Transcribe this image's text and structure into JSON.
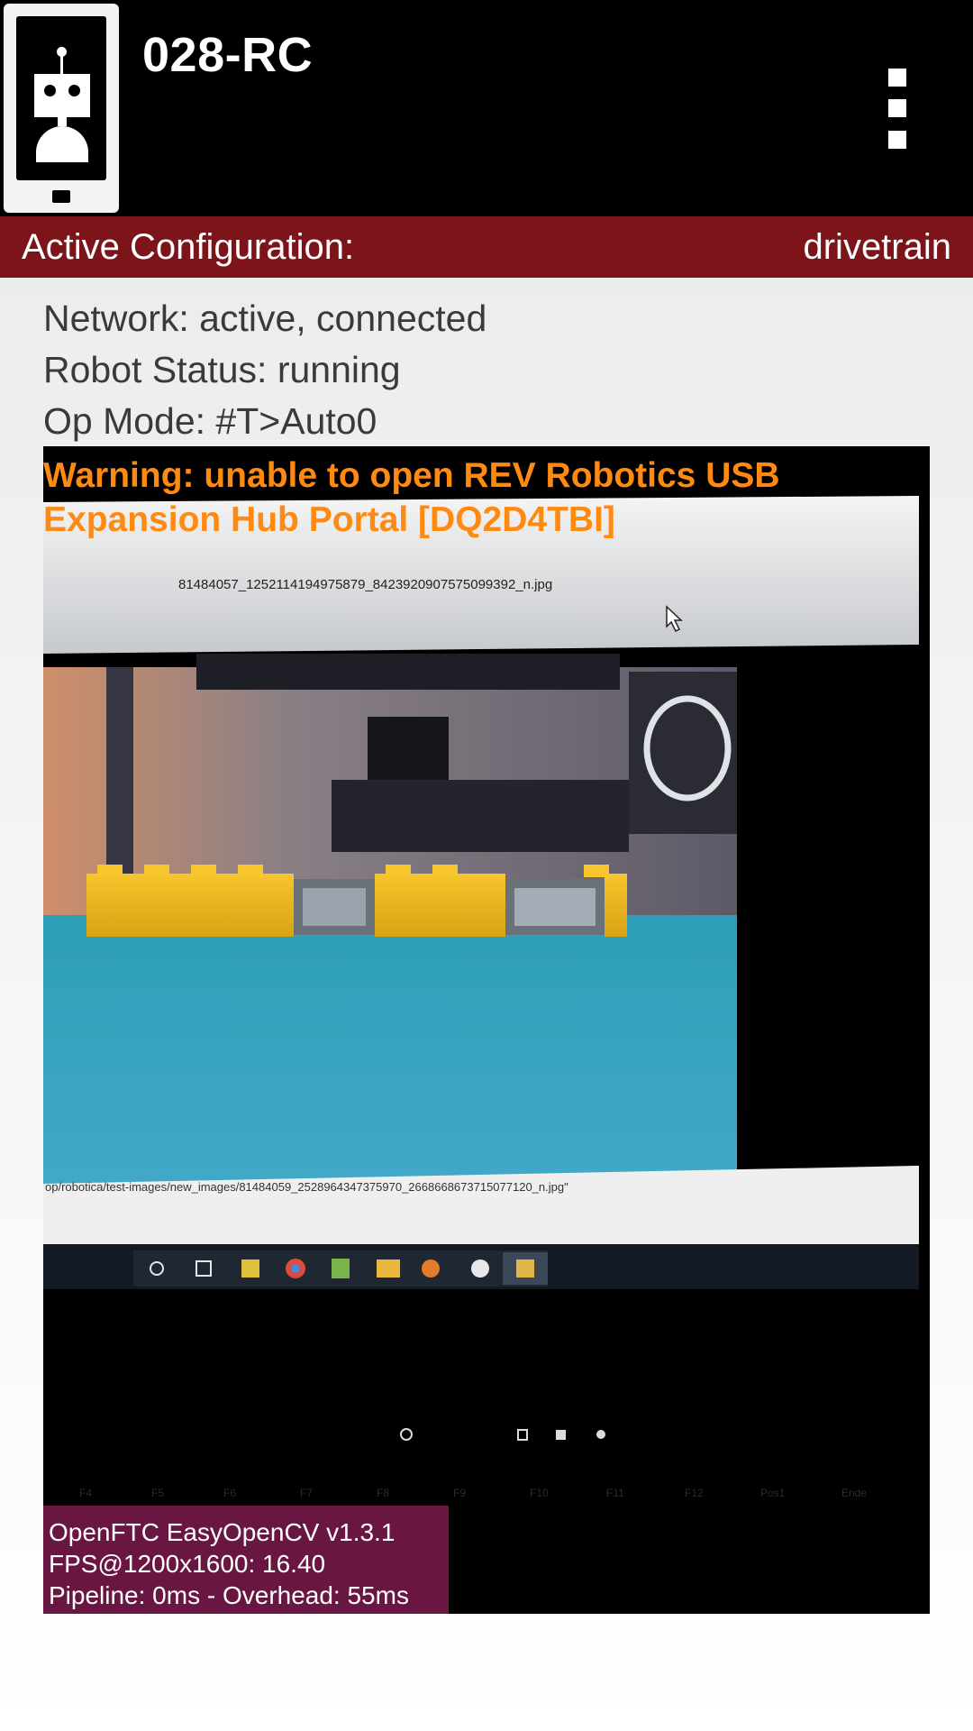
{
  "app_bar": {
    "title": "028-RC",
    "icon": "robot-phone-icon",
    "menu_icon": "overflow-menu-icon"
  },
  "config": {
    "label": "Active Configuration:",
    "value": "drivetrain"
  },
  "status": {
    "network": "Network: active, connected",
    "robot": "Robot Status: running",
    "op_mode": "Op Mode: #T>Auto0"
  },
  "camera": {
    "warning_line1": "Warning: unable to open REV Robotics USB",
    "warning_line2": "Expansion Hub Portal [DQ2D4TBI]",
    "photo_top_filename": "81484057_1252114194975879_8423920907575099392_n.jpg",
    "photo_bottom_path": "op/robotica/test-images/new_images/81484059_2528964347375970_2668668673715077120_n.jpg\"",
    "keyboard_keys": [
      "F4",
      "F5",
      "F6",
      "F7",
      "F8",
      "F9",
      "F10",
      "F11",
      "F12",
      "Pos1",
      "Ende"
    ],
    "fps_overlay": {
      "line1": "OpenFTC EasyOpenCV v1.3.1",
      "line2": "FPS@1200x1600: 16.40",
      "line3": "Pipeline: 0ms - Overhead: 55ms"
    }
  },
  "colors": {
    "app_bar": "#000000",
    "config_bar": "#7d141a",
    "warning_text": "#ff8a12",
    "fps_overlay": "#6a1642"
  }
}
